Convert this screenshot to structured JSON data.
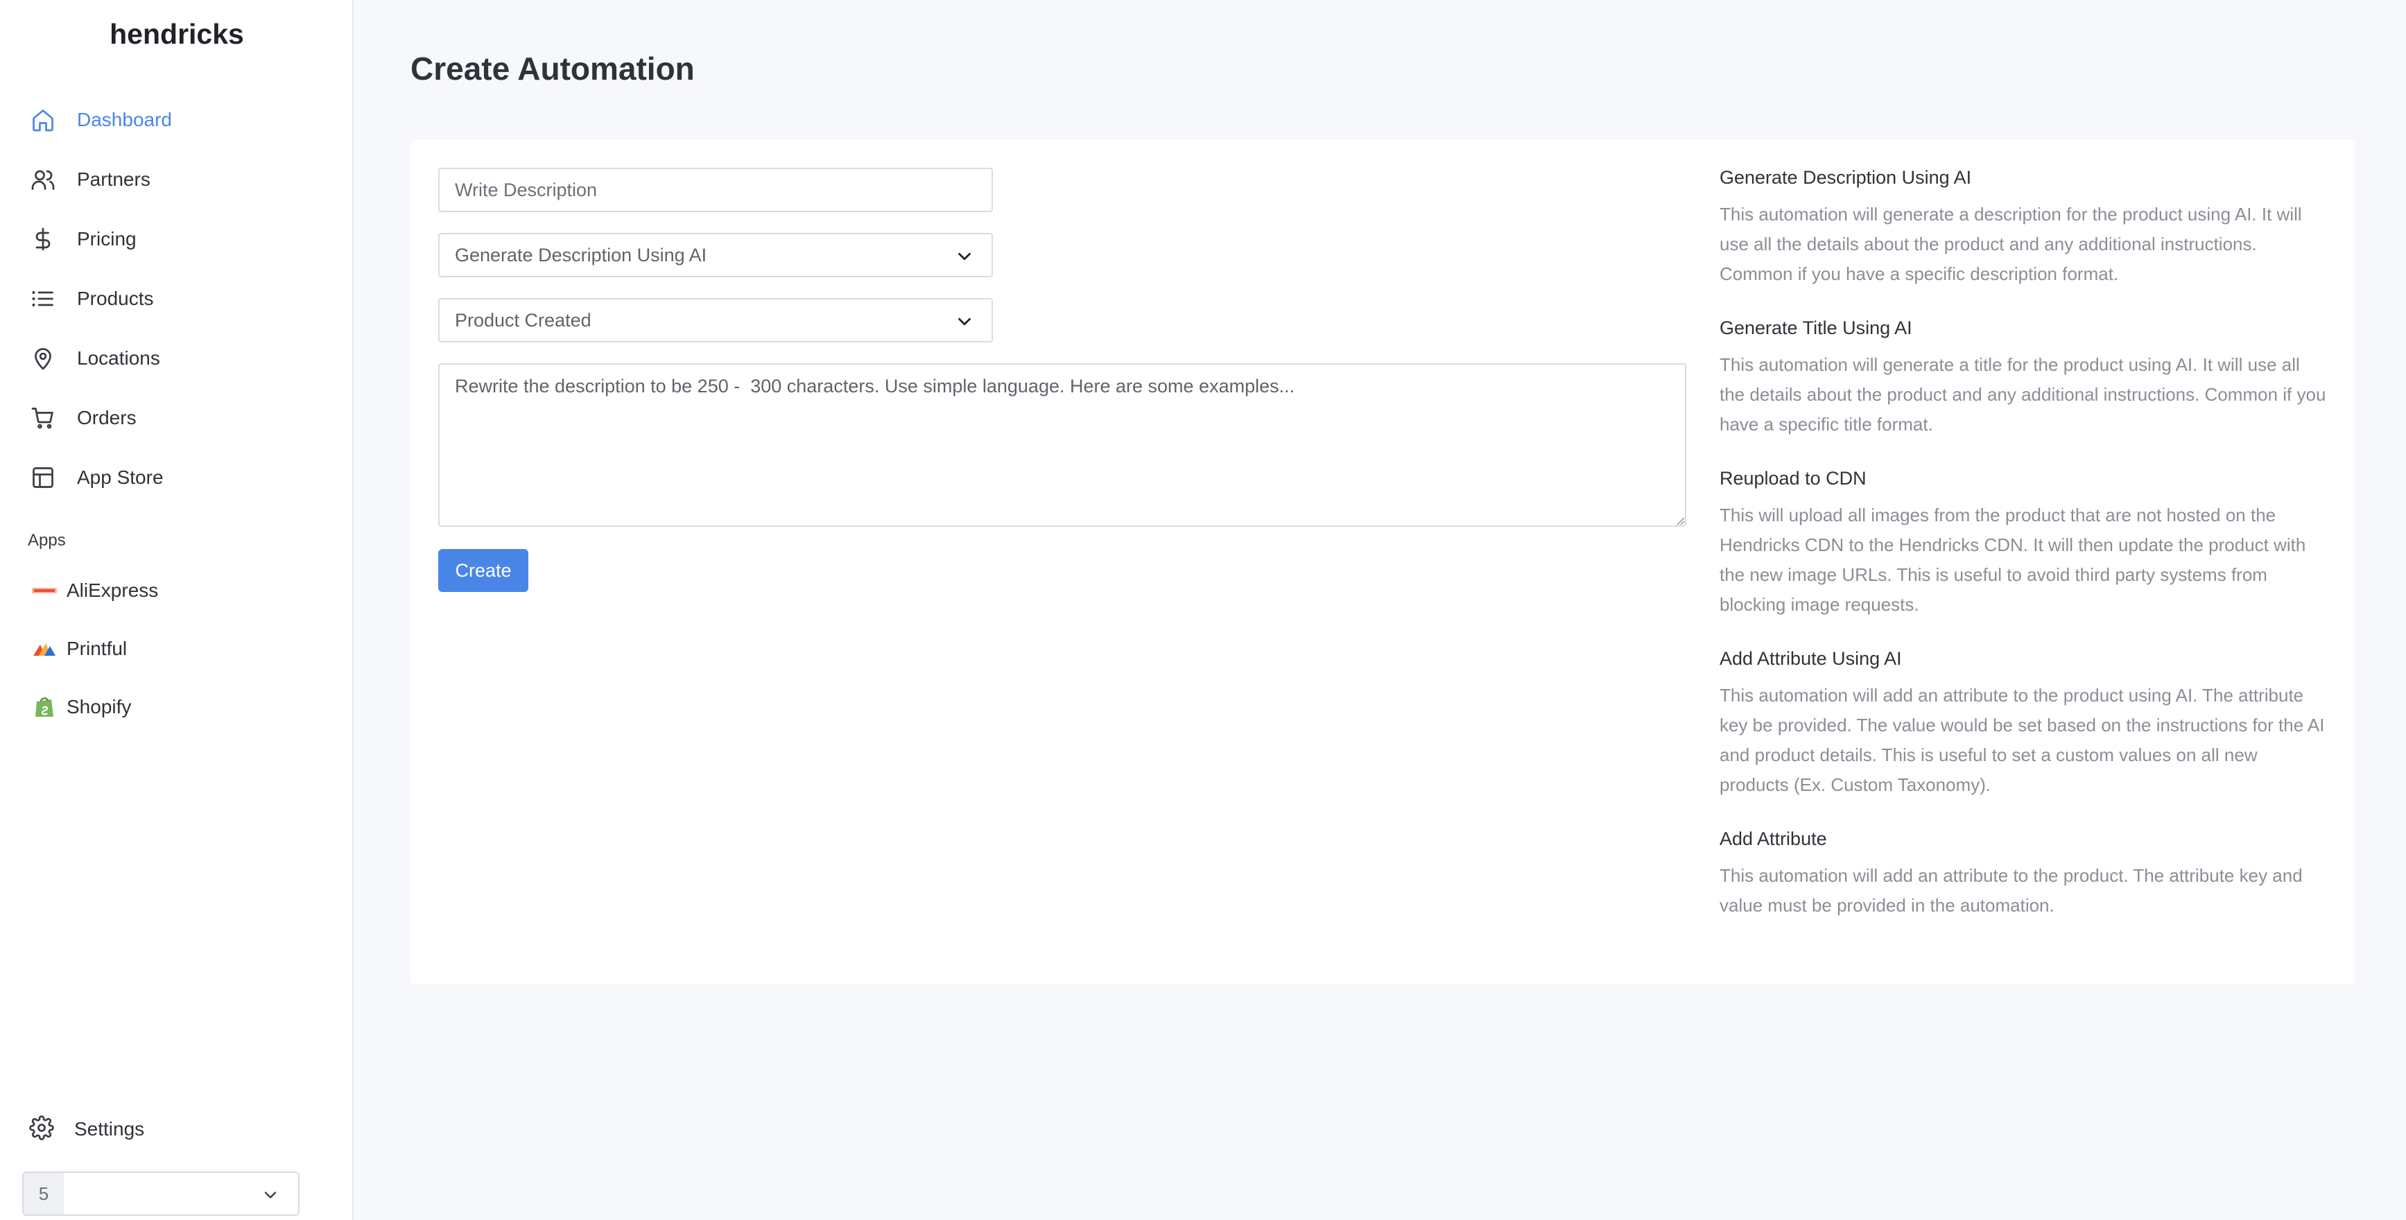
{
  "brand": "hendricks",
  "nav": [
    {
      "label": "Dashboard",
      "icon": "home-icon",
      "active": true
    },
    {
      "label": "Partners",
      "icon": "users-icon",
      "active": false
    },
    {
      "label": "Pricing",
      "icon": "dollar-icon",
      "active": false
    },
    {
      "label": "Products",
      "icon": "list-icon",
      "active": false
    },
    {
      "label": "Locations",
      "icon": "map-pin-icon",
      "active": false
    },
    {
      "label": "Orders",
      "icon": "cart-icon",
      "active": false
    },
    {
      "label": "App Store",
      "icon": "layout-icon",
      "active": false
    }
  ],
  "apps_section": "Apps",
  "apps": [
    {
      "label": "AliExpress",
      "icon": "aliexpress-logo"
    },
    {
      "label": "Printful",
      "icon": "printful-logo"
    },
    {
      "label": "Shopify",
      "icon": "shopify-logo"
    }
  ],
  "settings_label": "Settings",
  "org": {
    "badge": "5",
    "value": ""
  },
  "page_title": "Create Automation",
  "form": {
    "description_placeholder": "Write Description",
    "automation_type": "Generate Description Using AI",
    "trigger": "Product Created",
    "instructions": "Rewrite the description to be 250 -  300 characters. Use simple language. Here are some examples...",
    "submit_label": "Create"
  },
  "docs": [
    {
      "title": "Generate Description Using AI",
      "text": "This automation will generate a description for the product using AI. It will use all the details about the product and any additional instructions. Common if you have a specific description format."
    },
    {
      "title": "Generate Title Using AI",
      "text": "This automation will generate a title for the product using AI. It will use all the details about the product and any additional instructions. Common if you have a specific title format."
    },
    {
      "title": "Reupload to CDN",
      "text": "This will upload all images from the product that are not hosted on the Hendricks CDN to the Hendricks CDN. It will then update the product with the new image URLs. This is useful to avoid third party systems from blocking image requests."
    },
    {
      "title": "Add Attribute Using AI",
      "text": "This automation will add an attribute to the product using AI. The attribute key be provided. The value would be set based on the instructions for the AI and product details. This is useful to set a custom values on all new products (Ex. Custom Taxonomy)."
    },
    {
      "title": "Add Attribute",
      "text": "This automation will add an attribute to the product. The attribute key and value must be provided in the automation."
    }
  ],
  "colors": {
    "accent": "#4a86e8",
    "muted_text": "#8a8e96",
    "background": "#f7f8fc"
  }
}
